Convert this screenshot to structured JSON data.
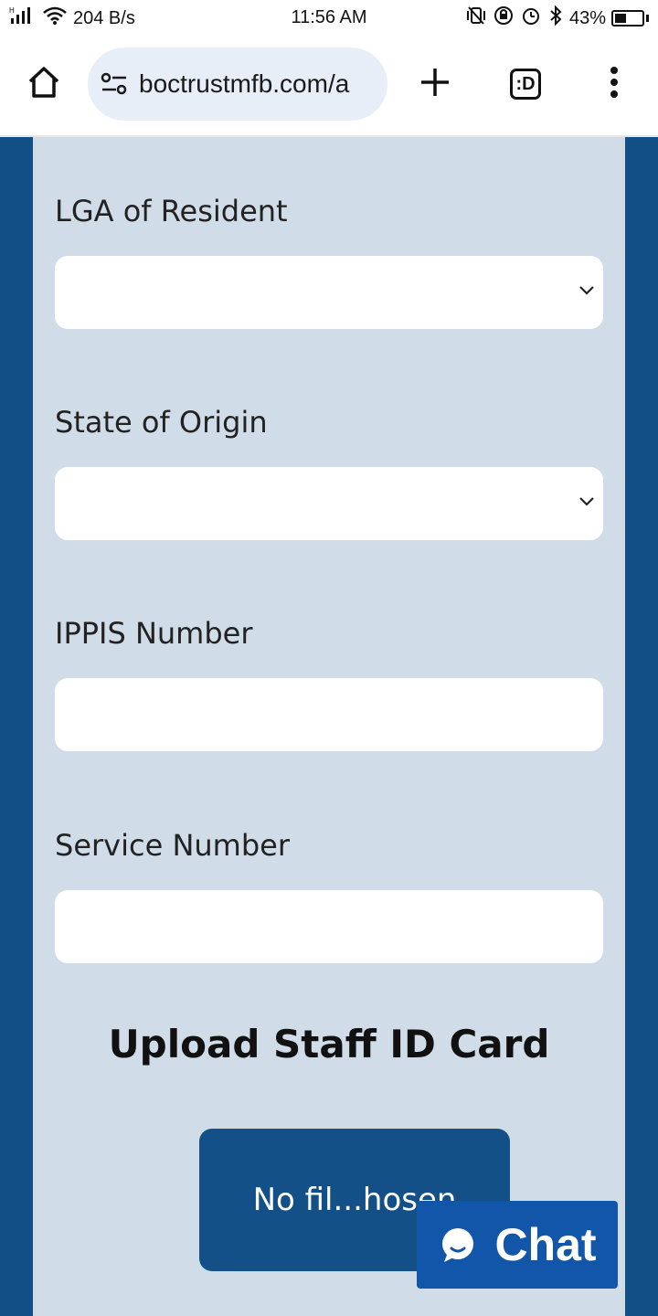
{
  "status_bar": {
    "network_speed": "204 B/s",
    "time": "11:56 AM",
    "battery": "43%",
    "battery_level": 0.43
  },
  "browser": {
    "url": "boctrustmfb.com/a",
    "tab_label": ":D"
  },
  "form": {
    "lga_label": "LGA of Resident",
    "lga_value": "",
    "state_label": "State of Origin",
    "state_value": "",
    "ippis_label": "IPPIS Number",
    "ippis_value": "",
    "service_label": "Service Number",
    "service_value": "",
    "upload_title": "Upload Staff ID Card",
    "file_button_label": "No fil...hosen"
  },
  "chat": {
    "label": "Chat"
  },
  "colors": {
    "page_background": "#124f85",
    "form_background": "#d0dce8",
    "chat_button": "#1156a8"
  }
}
